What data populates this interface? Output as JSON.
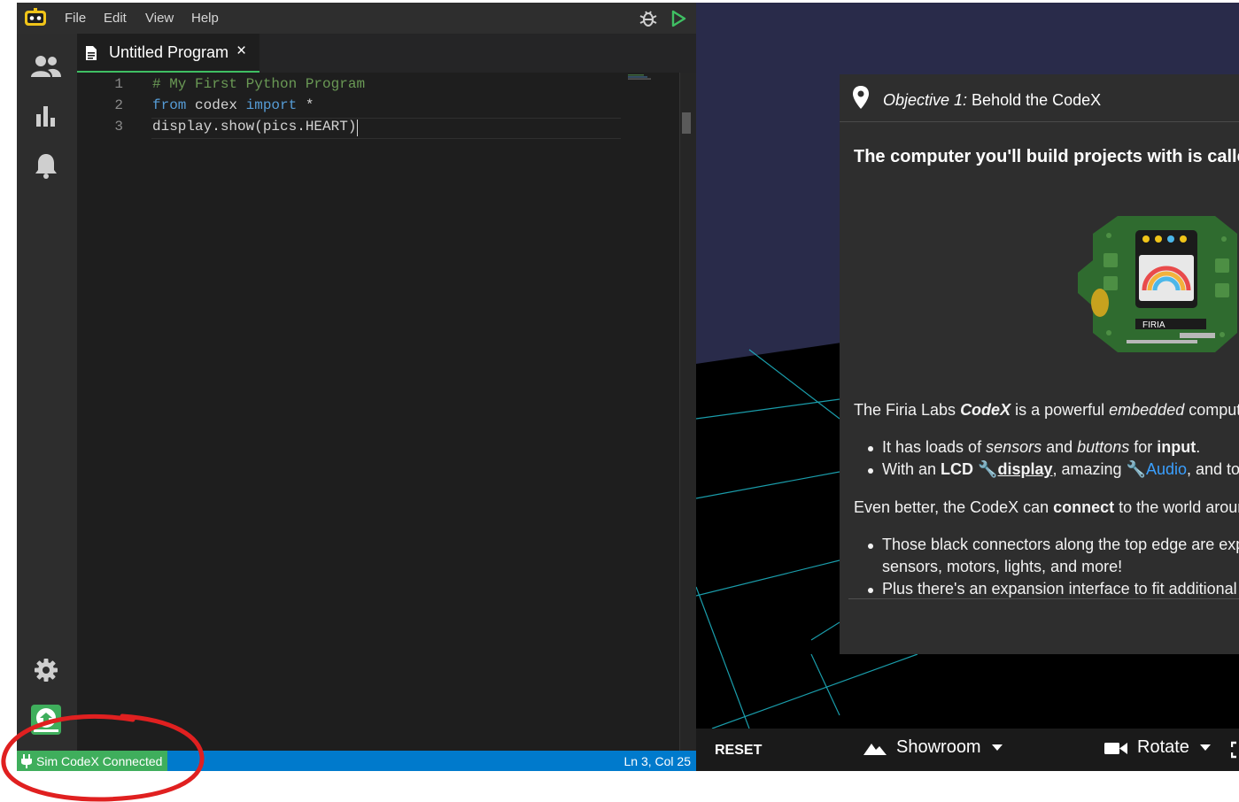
{
  "menu": {
    "file": "File",
    "edit": "Edit",
    "view": "View",
    "help": "Help"
  },
  "tab": {
    "title": "Untitled Program",
    "close": "×"
  },
  "editor": {
    "lines": [
      {
        "num": "1",
        "comment": "# My First Python Program"
      },
      {
        "num": "2",
        "kw1": "from",
        "mid": " codex ",
        "kw2": "import",
        "rest": " *"
      },
      {
        "num": "3",
        "code": "display.show(pics.HEART)"
      }
    ]
  },
  "status": {
    "connection": "Sim CodeX Connected",
    "position": "Ln 3, Col 25"
  },
  "objective": {
    "label": "Objective 1:",
    "title": " Behold the CodeX",
    "heading": "The computer you'll build projects with is called the CodeX",
    "p1": {
      "a": "The Firia Labs ",
      "b": "CodeX",
      "c": " is a powerful ",
      "d": "embedded",
      "e": " computer"
    },
    "b1": {
      "a": "It has loads of ",
      "b": "sensors",
      "c": " and ",
      "d": "buttons",
      "e": " for ",
      "f": "input",
      "g": "."
    },
    "b2": {
      "a": "With an ",
      "b": "LCD",
      "c": "display",
      "d": ", amazing ",
      "e": "Audio",
      "f": ", and tone"
    },
    "p2": {
      "a": "Even better, the CodeX can ",
      "b": "connect",
      "c": " to the world around it"
    },
    "b3a": "Those black connectors along the top edge are expansion ports for",
    "b3b": "sensors, motors, lights, and more!",
    "b4": "Plus there's an expansion interface to fit additional hardware"
  },
  "simbar": {
    "reset": "RESET",
    "showroom": "Showroom",
    "rotate": "Rotate"
  },
  "board": {
    "brand": "FIRIA"
  },
  "colors": {
    "accent_green": "#3fae5c",
    "status_blue": "#007acc",
    "annotation_red": "#e02020",
    "link_blue": "#3aa0ff"
  }
}
